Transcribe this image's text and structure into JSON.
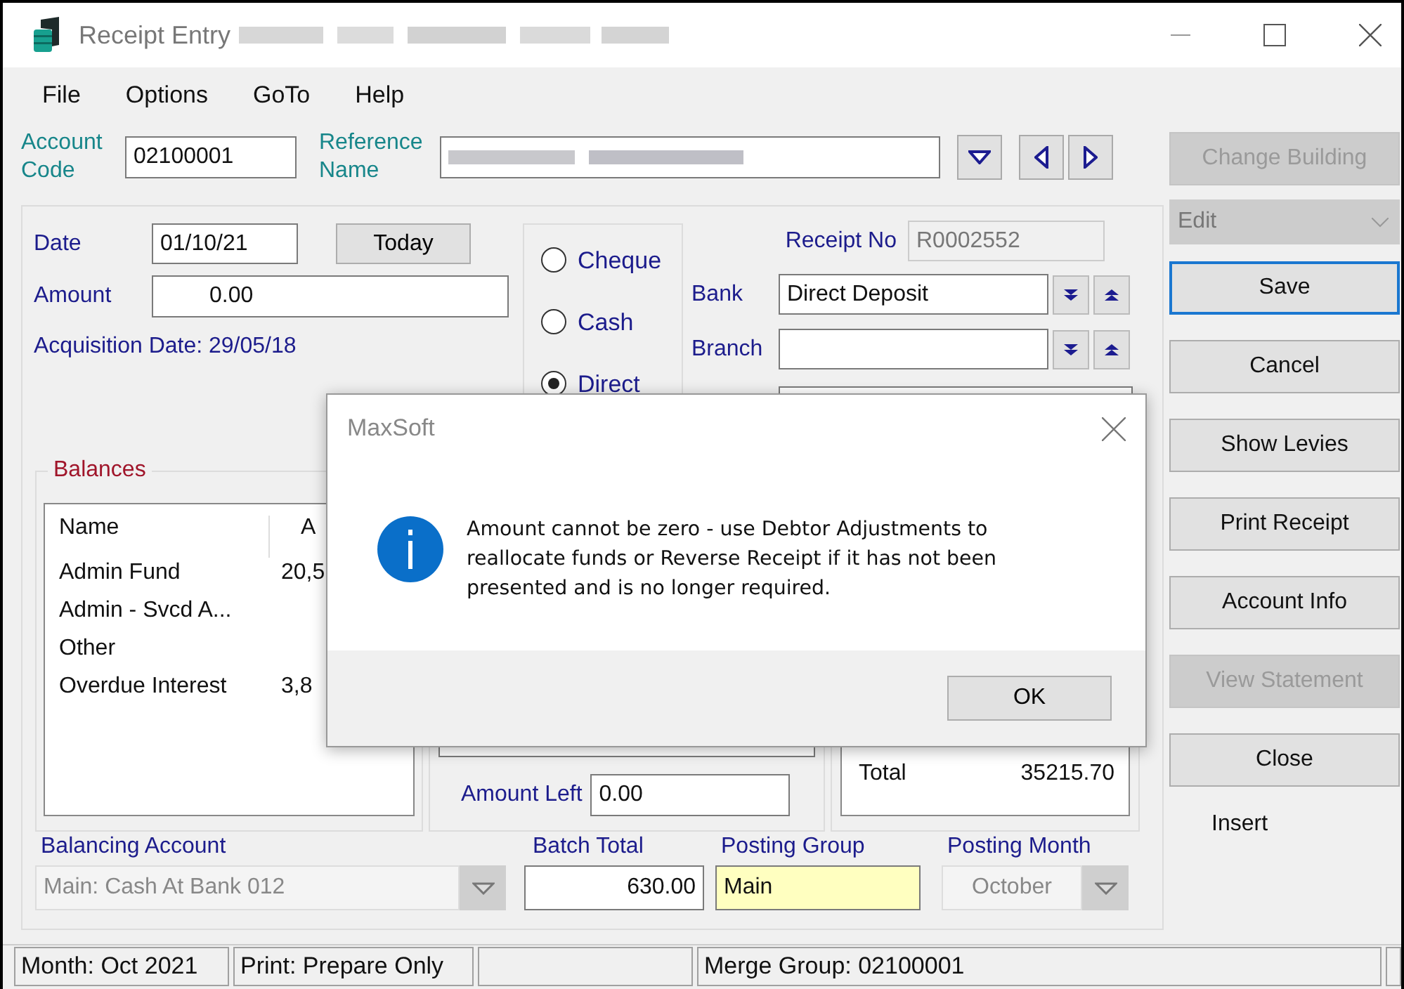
{
  "window": {
    "title": "Receipt Entry"
  },
  "menu": [
    "File",
    "Options",
    "GoTo",
    "Help"
  ],
  "account_code": {
    "label": "Account Code",
    "value": "02100001"
  },
  "reference_name": {
    "label": "Reference Name"
  },
  "date": {
    "label": "Date",
    "value": "01/10/21",
    "button": "Today"
  },
  "amount": {
    "label": "Amount",
    "value": "0.00"
  },
  "acquisition": "Acquisition Date: 29/05/18",
  "payment_types": [
    {
      "label": "Cheque",
      "selected": false
    },
    {
      "label": "Cash",
      "selected": false
    },
    {
      "label": "Direct",
      "selected": true
    }
  ],
  "receipt_no": {
    "label": "Receipt No",
    "value": "R0002552"
  },
  "bank": {
    "label": "Bank",
    "value": "Direct Deposit"
  },
  "branch": {
    "label": "Branch"
  },
  "balances": {
    "title": "Balances",
    "columns": [
      "Name",
      "A"
    ],
    "rows": [
      {
        "name": "Admin Fund",
        "amount": "20,5"
      },
      {
        "name": "Admin - Svcd A..."
      },
      {
        "name": "Other"
      },
      {
        "name": "Overdue Interest",
        "amount": "3,8"
      }
    ]
  },
  "amount_left": {
    "label": "Amount Left",
    "value": "0.00"
  },
  "total": {
    "label": "Total",
    "value": "35215.70"
  },
  "balancing_account": {
    "label": "Balancing Account",
    "value": "Main: Cash At Bank 012"
  },
  "batch_total": {
    "label": "Batch Total",
    "value": "630.00"
  },
  "posting_group": {
    "label": "Posting Group",
    "value": "Main"
  },
  "posting_month": {
    "label": "Posting Month",
    "value": "October"
  },
  "mode_select": {
    "value": "Edit"
  },
  "side_buttons": [
    {
      "label": "Change Building",
      "disabled": true,
      "focused": false
    },
    {
      "label": "Save",
      "disabled": false,
      "focused": true
    },
    {
      "label": "Cancel",
      "disabled": false,
      "focused": false
    },
    {
      "label": "Show Levies",
      "disabled": false,
      "focused": false
    },
    {
      "label": "Print Receipt",
      "disabled": false,
      "focused": false
    },
    {
      "label": "Account Info",
      "disabled": false,
      "focused": false
    },
    {
      "label": "View Statement",
      "disabled": true,
      "focused": false
    },
    {
      "label": "Close",
      "disabled": false,
      "focused": false
    }
  ],
  "insert_label": "Insert",
  "status_bar": [
    "Month: Oct 2021",
    "Print: Prepare Only",
    "Merge Group: 02100001"
  ],
  "dialog": {
    "title": "MaxSoft",
    "message": "Amount cannot be zero - use Debtor Adjustments to reallocate funds or Reverse Receipt if it has not been presented and is no longer required.",
    "ok": "OK"
  }
}
